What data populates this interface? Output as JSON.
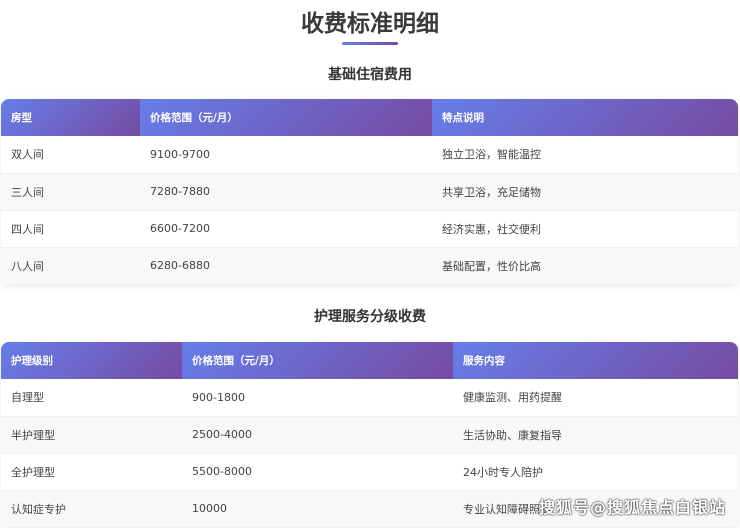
{
  "title": "收费标准明细",
  "section1": {
    "title": "基础住宿费用",
    "headers": [
      "房型",
      "价格范围（元/月）",
      "特点说明"
    ],
    "rows": [
      [
        "双人间",
        "9100-9700",
        "独立卫浴，智能温控"
      ],
      [
        "三人间",
        "7280-7880",
        "共享卫浴，充足储物"
      ],
      [
        "四人间",
        "6600-7200",
        "经济实惠，社交便利"
      ],
      [
        "八人间",
        "6280-6880",
        "基础配置，性价比高"
      ]
    ]
  },
  "section2": {
    "title": "护理服务分级收费",
    "headers": [
      "护理级别",
      "价格范围（元/月）",
      "服务内容"
    ],
    "rows": [
      [
        "自理型",
        "900-1800",
        "健康监测、用药提醒"
      ],
      [
        "半护理型",
        "2500-4000",
        "生活协助、康复指导"
      ],
      [
        "全护理型",
        "5500-8000",
        "24小时专人陪护"
      ],
      [
        "认知症专护",
        "10000",
        "专业认知障碍照护"
      ]
    ]
  },
  "watermark": "搜狐号@搜狐焦点白银站"
}
